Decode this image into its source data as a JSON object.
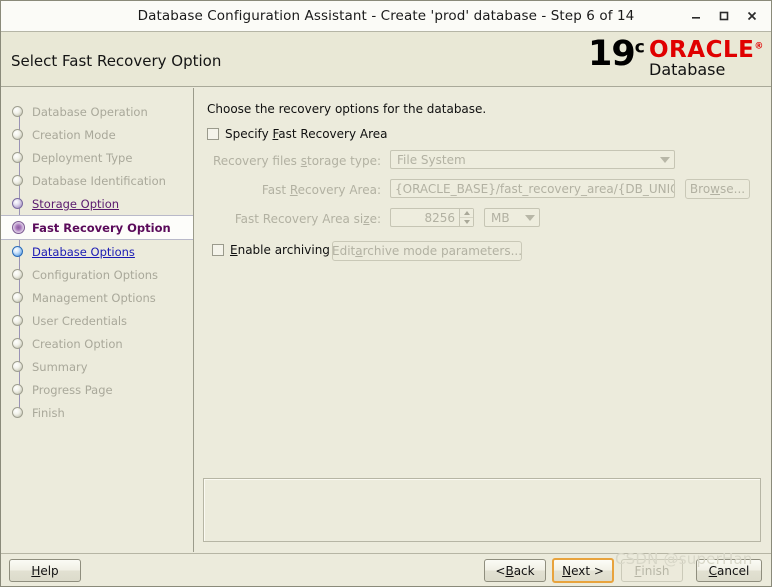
{
  "window": {
    "title": "Database Configuration Assistant - Create 'prod' database - Step 6 of 14",
    "minimize_icon": "minimize-icon",
    "maximize_icon": "maximize-icon",
    "close_icon": "close-icon"
  },
  "header": {
    "title": "Select Fast Recovery Option",
    "logo": {
      "version": "19",
      "version_sup": "c",
      "brand": "ORACLE",
      "brand_sup": "®",
      "product": "Database"
    }
  },
  "sidebar": {
    "steps": [
      {
        "label": "Database Operation",
        "state": "done"
      },
      {
        "label": "Creation Mode",
        "state": "done"
      },
      {
        "label": "Deployment Type",
        "state": "done"
      },
      {
        "label": "Database Identification",
        "state": "done"
      },
      {
        "label": "Storage Option",
        "state": "visited"
      },
      {
        "label": "Fast Recovery Option",
        "state": "current"
      },
      {
        "label": "Database Options",
        "state": "next"
      },
      {
        "label": "Configuration Options",
        "state": "done"
      },
      {
        "label": "Management Options",
        "state": "done"
      },
      {
        "label": "User Credentials",
        "state": "done"
      },
      {
        "label": "Creation Option",
        "state": "done"
      },
      {
        "label": "Summary",
        "state": "done"
      },
      {
        "label": "Progress Page",
        "state": "done"
      },
      {
        "label": "Finish",
        "state": "done"
      }
    ]
  },
  "main": {
    "intro": "Choose the recovery options for the database.",
    "specify_fra": {
      "label_pre": "Specify ",
      "label_mn": "F",
      "label_post": "ast Recovery Area",
      "checked": false
    },
    "storage_type": {
      "label_pre": "Recovery files ",
      "label_mn": "s",
      "label_post": "torage type:",
      "value": "File System"
    },
    "fra_path": {
      "label_pre": "Fast ",
      "label_mn": "R",
      "label_post": "ecovery Area:",
      "value": "{ORACLE_BASE}/fast_recovery_area/{DB_UNIQUE_",
      "browse_pre": "Bro",
      "browse_mn": "w",
      "browse_post": "se..."
    },
    "fra_size": {
      "label_pre": "Fast Recovery Area si",
      "label_mn": "z",
      "label_post": "e:",
      "value": "8256",
      "unit": "MB"
    },
    "enable_archiving": {
      "label_mn": "E",
      "label_post": "nable archiving",
      "checked": false,
      "edit_pre": "Edit ",
      "edit_mn": "a",
      "edit_post": "rchive mode parameters..."
    }
  },
  "footer": {
    "help": {
      "mn": "H",
      "post": "elp"
    },
    "back": {
      "pre": "< ",
      "mn": "B",
      "post": "ack"
    },
    "next": {
      "pre": "",
      "mn": "N",
      "post": "ext >"
    },
    "finish": {
      "mn": "F",
      "post": "inish"
    },
    "cancel": {
      "mn": "C",
      "post": "ancel"
    }
  },
  "watermark": "CSDN @superHan",
  "colors": {
    "background": "#ecebdc",
    "header": "#e9e8d6",
    "titlebar": "#fbfbf7",
    "oracle_red": "#e00000",
    "current_step": "#5a0a5a",
    "visited_step": "#5a1a6e",
    "next_step": "#1a1ab4",
    "disabled_text": "#b2b1a2",
    "focus_border": "#e8a33d"
  }
}
